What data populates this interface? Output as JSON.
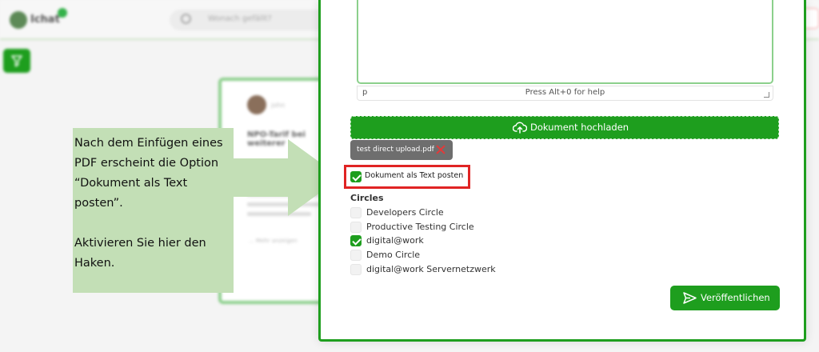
{
  "background": {
    "logo_text": "Ichat",
    "search_placeholder": "Wonach gefällt?",
    "post_card": {
      "author": "john",
      "title": "NPO-Tarif bei weiterer",
      "more_link": "... Mehr anzeigen"
    }
  },
  "annotation": {
    "text": "Nach dem Einfügen eines PDF erscheint die Option “Dokument als Text posten”.\n\nAktivieren Sie hier den Haken.",
    "color": "#c3dfb6"
  },
  "modal": {
    "editor": {
      "path": "p",
      "help": "Press Alt+0 for help"
    },
    "upload_button": {
      "label": "Dokument hochladen",
      "icon": "cloud-upload-icon"
    },
    "attachment": {
      "filename": "test direct upload.pdf",
      "remove_icon": "close-icon"
    },
    "post_as_text": {
      "label": "Dokument als Text posten",
      "checked": true
    },
    "circles": {
      "title": "Circles",
      "items": [
        {
          "label": "Developers Circle",
          "checked": false
        },
        {
          "label": "Productive Testing Circle",
          "checked": false
        },
        {
          "label": "digital@work",
          "checked": true
        },
        {
          "label": "Demo Circle",
          "checked": false
        },
        {
          "label": "digital@work Servernetzwerk",
          "checked": false
        }
      ]
    },
    "publish_button": {
      "label": "Veröffentlichen",
      "icon": "send-icon"
    }
  },
  "colors": {
    "accent": "#1e9e1e",
    "highlight": "#e02424"
  }
}
